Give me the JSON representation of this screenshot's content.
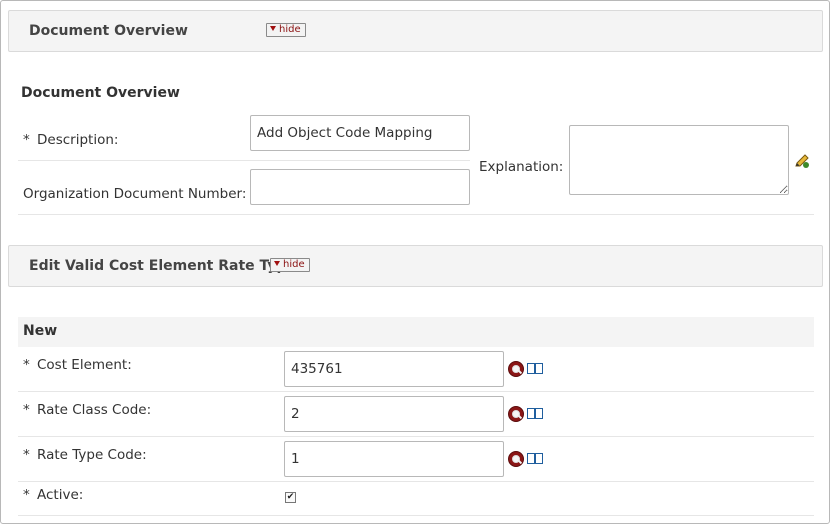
{
  "doc_overview": {
    "header_title": "Document Overview",
    "hide_label": "hide",
    "subtitle": "Document Overview",
    "required_mark": "*",
    "description_label": "Description:",
    "description_value": "Add Object Code Mapping",
    "org_doc_number_label": "Organization Document Number:",
    "org_doc_number_value": "",
    "explanation_label": "Explanation:",
    "explanation_value": ""
  },
  "rate_types": {
    "header_title": "Edit Valid Cost Element Rate Types",
    "hide_label": "hide",
    "new_label": "New",
    "fields": [
      {
        "label": "Cost Element:",
        "value": "435761"
      },
      {
        "label": "Rate Class Code:",
        "value": "2"
      },
      {
        "label": "Rate Type Code:",
        "value": "1"
      }
    ],
    "active_label": "Active:",
    "active_checked": true,
    "required_mark": "*"
  },
  "icons": {
    "lookup": "search-icon",
    "inquiry": "book-icon",
    "edit": "pencil-icon"
  },
  "colors": {
    "header_bg": "#f4f4f4",
    "hide_text": "#8a1010",
    "lookup_icon": "#8a1616",
    "book_icon": "#1f5e9e"
  }
}
